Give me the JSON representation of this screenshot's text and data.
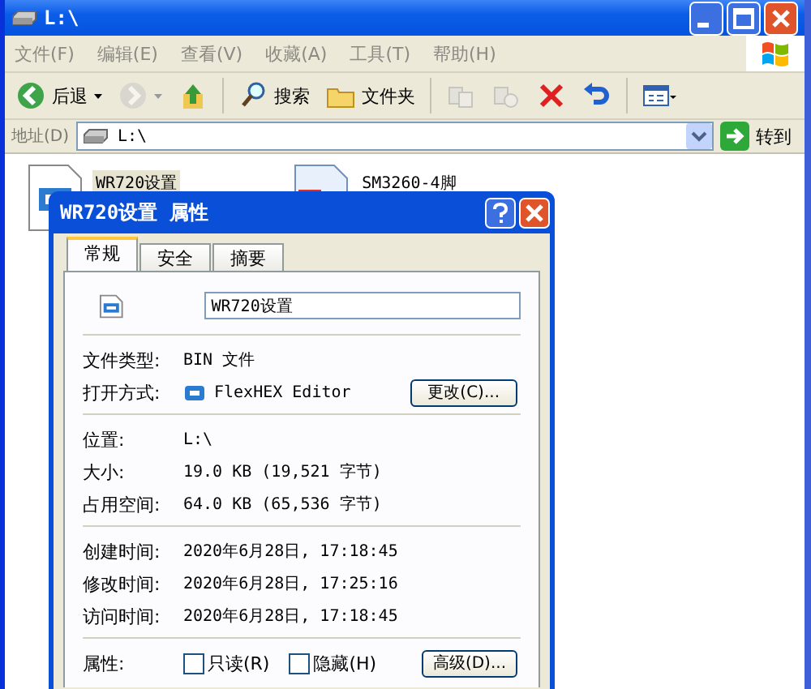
{
  "window": {
    "title": "L:\\"
  },
  "menu": [
    "文件(F)",
    "编辑(E)",
    "查看(V)",
    "收藏(A)",
    "工具(T)",
    "帮助(H)"
  ],
  "toolbar": [
    {
      "kind": "back",
      "label": "后退",
      "disabled": false
    },
    {
      "kind": "forward",
      "disabled": true
    },
    {
      "kind": "up",
      "disabled": false
    },
    {
      "kind": "search",
      "label": "搜索",
      "disabled": false
    },
    {
      "kind": "folders",
      "label": "文件夹",
      "disabled": false
    },
    {
      "kind": "move",
      "disabled": true
    },
    {
      "kind": "copy",
      "disabled": true
    },
    {
      "kind": "delete",
      "disabled": false
    },
    {
      "kind": "undo",
      "disabled": false
    },
    {
      "kind": "views",
      "disabled": false
    }
  ],
  "address": {
    "label": "地址(D)",
    "value": "L:\\",
    "go": "转到"
  },
  "files": [
    {
      "name": "WR720设置",
      "kind": "bin",
      "selected": true
    },
    {
      "name": "SM3260-4脚",
      "kind": "image",
      "selected": false
    }
  ],
  "dialog": {
    "title": "WR720设置 属性",
    "tabs": [
      {
        "label": "常规",
        "selected": true
      },
      {
        "label": "安全",
        "selected": false
      },
      {
        "label": "摘要",
        "selected": false
      }
    ],
    "name": "WR720设置",
    "groups": [
      [
        {
          "label": "文件类型:",
          "value": "BIN 文件"
        },
        {
          "label": "打开方式:",
          "value": "FlexHEX Editor",
          "kind": "app",
          "button": "更改(C)..."
        }
      ],
      [
        {
          "label": "位置:",
          "value": "L:\\"
        },
        {
          "label": "大小:",
          "value": "19.0 KB (19,521 字节)"
        },
        {
          "label": "占用空间:",
          "value": "64.0 KB (65,536 字节)"
        }
      ],
      [
        {
          "label": "创建时间:",
          "value": "2020年6月28日, 17:18:45"
        },
        {
          "label": "修改时间:",
          "value": "2020年6月28日, 17:25:16"
        },
        {
          "label": "访问时间:",
          "value": "2020年6月28日, 17:18:45"
        }
      ]
    ],
    "attributes": {
      "label": "属性:",
      "checkboxes": [
        {
          "label": "只读(R)",
          "checked": false
        },
        {
          "label": "隐藏(H)",
          "checked": false
        }
      ],
      "button": "高级(D)..."
    }
  }
}
